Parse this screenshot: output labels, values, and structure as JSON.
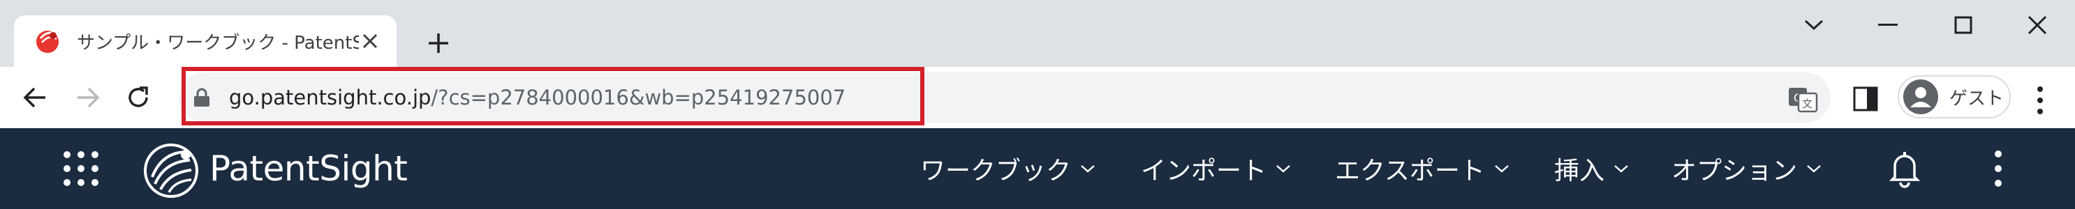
{
  "browser": {
    "tab": {
      "title": "サンプル・ワークブック - PatentSight",
      "favicon": "patentsight-favicon"
    },
    "window_controls": [
      "chevron-down-icon",
      "minimize-icon",
      "maximize-icon",
      "close-icon"
    ],
    "address": {
      "host": "go.patentsight.co.jp",
      "path": "/?cs=p2784000016&wb=p25419275007"
    },
    "profile": {
      "label": "ゲスト"
    },
    "highlight_color": "#d3202a"
  },
  "app": {
    "logo_text": "PatentSight",
    "nav": [
      {
        "label": "ワークブック"
      },
      {
        "label": "インポート"
      },
      {
        "label": "エクスポート"
      },
      {
        "label": "挿入"
      },
      {
        "label": "オプション"
      }
    ],
    "bar_color": "#1b2b40"
  }
}
